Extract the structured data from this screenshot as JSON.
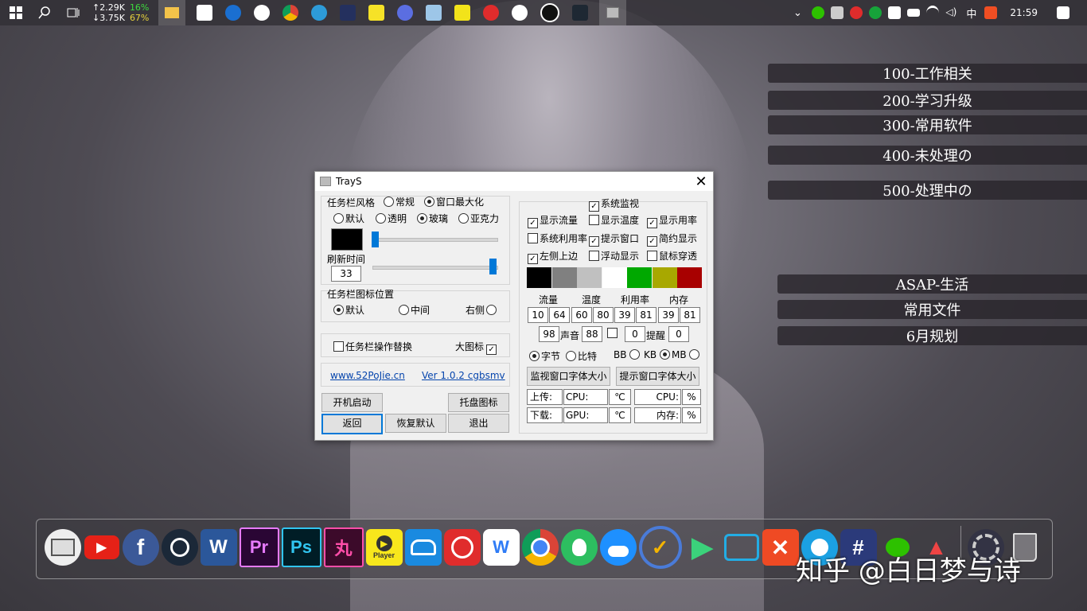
{
  "taskbar": {
    "net_up": "↑2.29K",
    "net_down": "↓3.75K",
    "cpu_pct": "16%",
    "mem_pct": "67%",
    "lang": "中",
    "clock": "21:59"
  },
  "desktop_labels": [
    "100-工作相关",
    "200-学习升级",
    "300-常用软件",
    "400-未处理の",
    "500-处理中の",
    "ASAP-生活",
    "常用文件",
    "6月规划"
  ],
  "dialog": {
    "title": "TrayS",
    "style_group": "任务栏风格",
    "opt_normal": "常规",
    "opt_maximize": "窗口最大化",
    "opt_default": "默认",
    "opt_transparent": "透明",
    "opt_glass": "玻璃",
    "opt_acrylic": "亚克力",
    "refresh_label": "刷新时间",
    "refresh_value": "33",
    "icon_pos_group": "任务栏图标位置",
    "pos_default": "默认",
    "pos_center": "中间",
    "pos_right": "右侧",
    "replace_ops": "任务栏操作替换",
    "big_icon": "大图标",
    "link_site": "www.52PoJie.cn",
    "link_ver": "Ver 1.0.2 cgbsmv",
    "btn_autostart": "开机启动",
    "btn_tray_icon": "托盘图标",
    "btn_back": "返回",
    "btn_restore": "恢复默认",
    "btn_exit": "退出",
    "sys_monitor": "系统监视",
    "show_traffic": "显示流量",
    "show_temp": "显示温度",
    "show_usage": "显示用率",
    "sys_usage": "系统利用率",
    "tip_window": "提示窗口",
    "simple_display": "简约显示",
    "left_top": "左侧上边",
    "float_display": "浮动显示",
    "mouse_through": "鼠标穿透",
    "swatch_colors": [
      "#000000",
      "#808080",
      "#c0c0c0",
      "#ffffff",
      "#00a800",
      "#a8a800",
      "#a80000"
    ],
    "col_traffic": "流量",
    "col_temp": "温度",
    "col_usage": "利用率",
    "col_mem": "内存",
    "vals": [
      "10",
      "64",
      "60",
      "80",
      "39",
      "81",
      "39",
      "81"
    ],
    "sound_val": "98",
    "sound_label": "声音",
    "sound_val2": "88",
    "remind_val1": "0",
    "remind_label": "提醒",
    "remind_val2": "0",
    "unit_byte": "字节",
    "unit_bit": "比特",
    "unit_bb": "BB",
    "unit_kb": "KB",
    "unit_mb": "MB",
    "btn_mon_font": "监视窗口字体大小",
    "btn_tip_font": "提示窗口字体大小",
    "upload": "上传:",
    "download": "下载:",
    "cpu_label": "CPU:",
    "gpu_label": "GPU:",
    "deg": "℃",
    "cpu2_label": "CPU:",
    "mem2_label": "内存:",
    "percent": "%"
  },
  "dock": {
    "player_label": "Player",
    "watermark": "知乎 @白日梦与诗"
  }
}
